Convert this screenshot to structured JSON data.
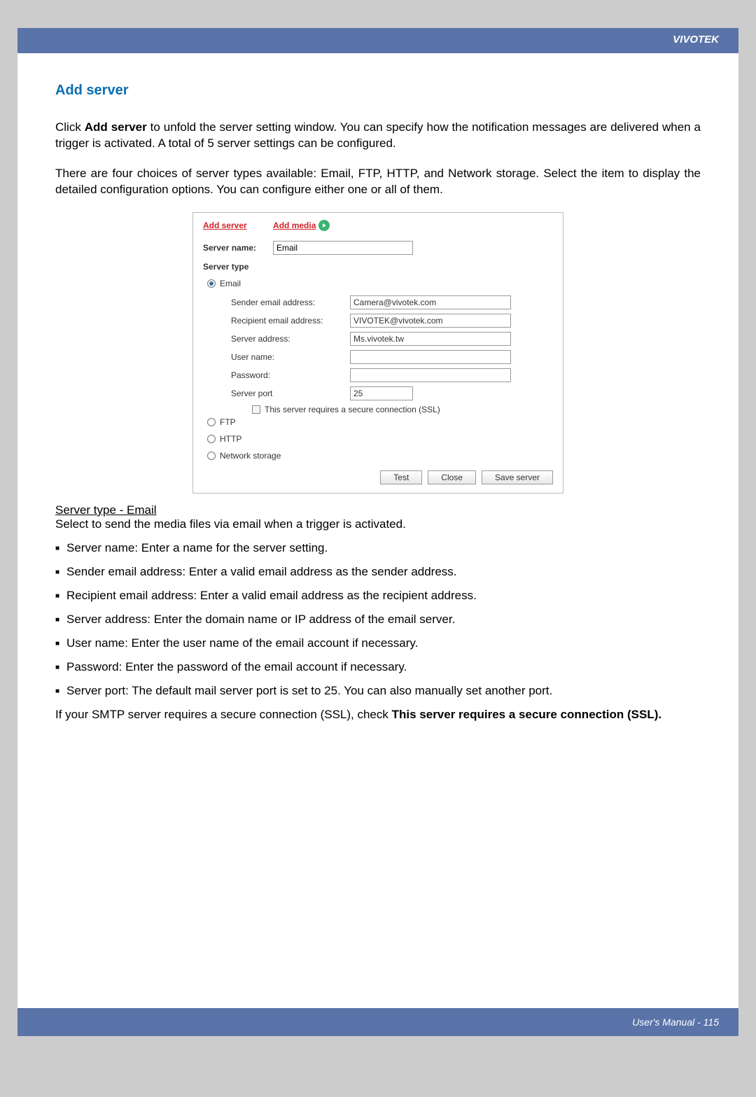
{
  "brand": "VIVOTEK",
  "page_title": "Add server",
  "intro_p1_a": "Click ",
  "intro_p1_bold": "Add server",
  "intro_p1_b": " to unfold the server setting window. You can specify how the notification messages are delivered when a trigger is activated. A total of 5 server settings can be configured.",
  "intro_p2": "There are four choices of server types available: Email, FTP, HTTP, and Network storage. Select the item to display the detailed configuration options. You can configure either one or all of them.",
  "dialog": {
    "tab_add_server": "Add server",
    "tab_add_media": "Add media",
    "server_name_label": "Server name:",
    "server_name_value": "Email",
    "server_type_label": "Server type",
    "opt_email": "Email",
    "opt_ftp": "FTP",
    "opt_http": "HTTP",
    "opt_network_storage": "Network storage",
    "sender_label": "Sender email address:",
    "sender_value": "Camera@vivotek.com",
    "recipient_label": "Recipient email address:",
    "recipient_value": "VIVOTEK@vivotek.com",
    "server_addr_label": "Server address:",
    "server_addr_value": "Ms.vivotek.tw",
    "user_label": "User name:",
    "user_value": "",
    "pass_label": "Password:",
    "pass_value": "",
    "port_label": "Server port",
    "port_value": "25",
    "ssl_label": "This server requires a secure connection (SSL)",
    "btn_test": "Test",
    "btn_close": "Close",
    "btn_save": "Save server"
  },
  "type_heading": "Server type - Email",
  "type_desc": "Select to send the media files via email when a trigger is activated.",
  "bullets": [
    "Server name: Enter a name for the server setting.",
    "Sender email address: Enter a valid email address as the sender address.",
    "Recipient email address: Enter a valid email address as the recipient address.",
    "Server address: Enter the domain name or IP address of the email server.",
    "User name: Enter the user name of the email account if necessary.",
    "Password: Enter the password of the email account if necessary.",
    "Server port: The default mail server port is set to 25. You can also manually set another port."
  ],
  "note_a": "If your SMTP server requires a secure connection (SSL), check ",
  "note_bold": "This server requires a secure connection (SSL).",
  "footer": "User's Manual - 115"
}
